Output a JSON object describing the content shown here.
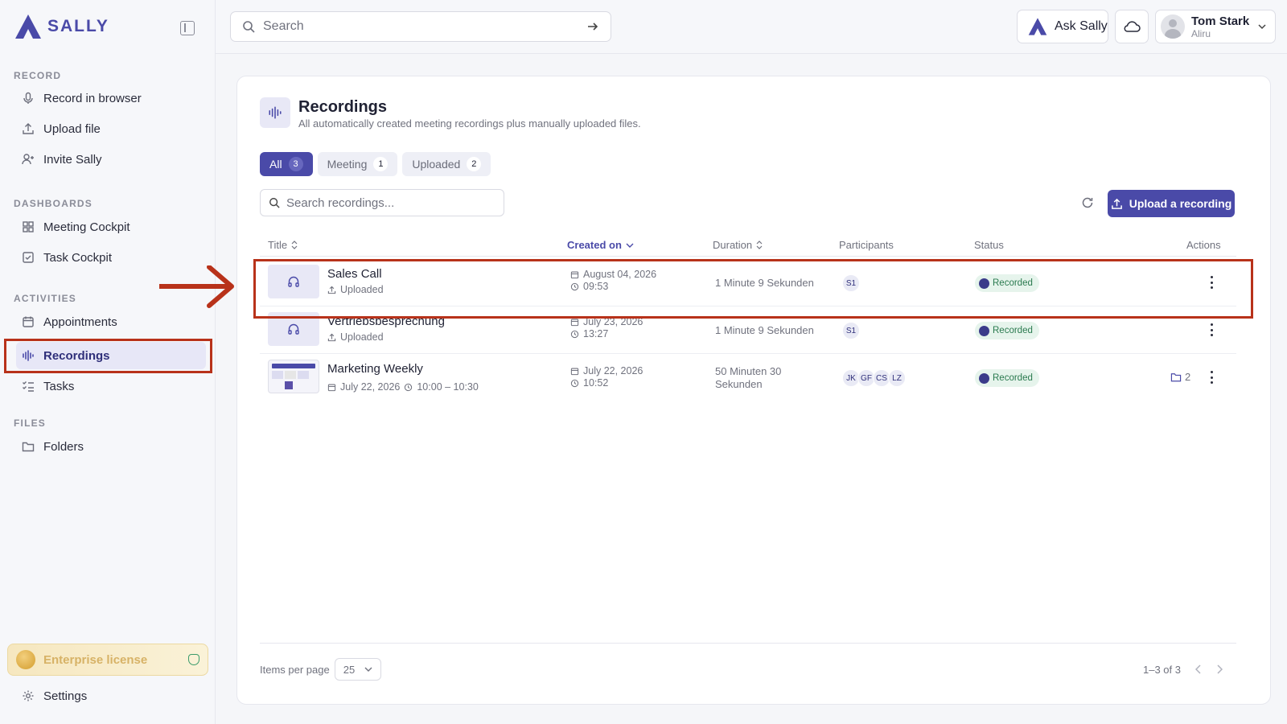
{
  "app": {
    "brand": "SALLY",
    "accent": "#4a4aa8",
    "highlight": "#b8321a"
  },
  "sidebar": {
    "sections": {
      "record": "RECORD",
      "dashboards": "DASHBOARDS",
      "activities": "ACTIVITIES",
      "files": "FILES"
    },
    "items": [
      {
        "label": "Record in browser",
        "icon": "microphone-icon"
      },
      {
        "label": "Upload file",
        "icon": "upload-icon"
      },
      {
        "label": "Invite Sally",
        "icon": "user-plus-icon"
      },
      {
        "label": "Meeting Cockpit",
        "icon": "grid-icon"
      },
      {
        "label": "Task Cockpit",
        "icon": "check-square-icon"
      },
      {
        "label": "Appointments",
        "icon": "calendar-icon"
      },
      {
        "label": "Recordings",
        "icon": "waveform-icon",
        "active": true
      },
      {
        "label": "Tasks",
        "icon": "list-check-icon"
      },
      {
        "label": "Folders",
        "icon": "folder-icon"
      }
    ],
    "license": "Enterprise license",
    "settings": "Settings"
  },
  "topbar": {
    "search_placeholder": "Search",
    "ask_label": "Ask Sally",
    "user": {
      "name": "Tom Stark",
      "org": "Aliru"
    }
  },
  "page": {
    "title": "Recordings",
    "subtitle": "All automatically created meeting recordings plus manually uploaded files.",
    "filters": [
      {
        "label": "All",
        "count": "3",
        "active": true
      },
      {
        "label": "Meeting",
        "count": "1"
      },
      {
        "label": "Uploaded",
        "count": "2"
      }
    ],
    "search_placeholder": "Search recordings...",
    "upload_label": "Upload a recording"
  },
  "table": {
    "headers": {
      "title": "Title",
      "created": "Created on",
      "duration": "Duration",
      "participants": "Participants",
      "status": "Status",
      "actions": "Actions"
    },
    "rows": [
      {
        "title": "Sales Call",
        "sub": "Uploaded",
        "date": "August 04, 2026",
        "time": "09:53",
        "duration": "1 Minute 9 Sekunden",
        "participants": [
          "S1"
        ],
        "status": "Recorded"
      },
      {
        "title": "Vertriebsbesprechung",
        "sub": "Uploaded",
        "date": "July 23, 2026",
        "time": "13:27",
        "duration": "1 Minute 9 Sekunden",
        "participants": [
          "S1"
        ],
        "status": "Recorded"
      },
      {
        "title": "Marketing Weekly",
        "sub_date": "July 22, 2026",
        "sub_time": "10:00 – 10:30",
        "date": "July 22, 2026",
        "time": "10:52",
        "duration_line1": "50 Minuten 30",
        "duration_line2": "Sekunden",
        "participants": [
          "JK",
          "GF",
          "CS",
          "LZ"
        ],
        "status": "Recorded",
        "folders": "2"
      }
    ]
  },
  "footer": {
    "items_per_page_label": "Items per page",
    "items_per_page": "25",
    "range": "1–3 of 3"
  }
}
